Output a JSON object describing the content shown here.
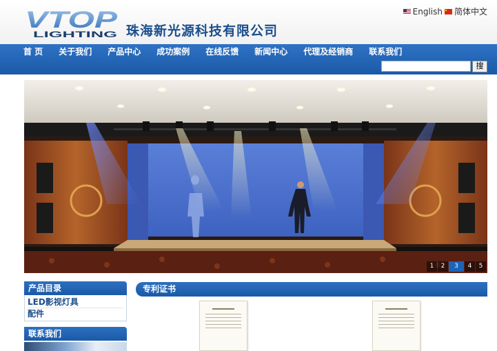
{
  "header": {
    "logo_text_main": "VTOP",
    "logo_text_sub": "LIGHTING",
    "company_name": "珠海新光源科技有限公司",
    "languages": [
      {
        "label": "English",
        "flag": "us-flag-icon"
      },
      {
        "label": "简体中文",
        "flag": "cn-flag-icon"
      }
    ]
  },
  "nav": {
    "items": [
      "首 页",
      "关于我们",
      "产品中心",
      "成功案例",
      "在线反馈",
      "新闻中心",
      "代理及经销商",
      "联系我们"
    ]
  },
  "search": {
    "value": "",
    "button_label": "搜"
  },
  "slider": {
    "dots": [
      "1",
      "2",
      "3",
      "4",
      "5"
    ],
    "active_index": 2
  },
  "sidebar": {
    "product_title": "产品目录",
    "product_links": [
      "LED影视灯具",
      "配件"
    ],
    "contact_title": "联系我们"
  },
  "main": {
    "section_title": "专利证书"
  },
  "colors": {
    "nav_blue": "#1a5aa8",
    "brand_blue": "#1b4e8c"
  }
}
